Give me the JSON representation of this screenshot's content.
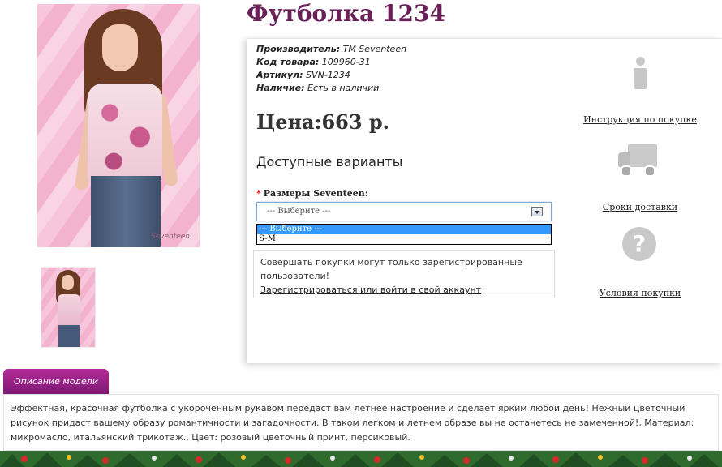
{
  "product": {
    "title": "Футболка 1234",
    "specs": [
      {
        "label": "Производитель:",
        "value": "TM Seventeen"
      },
      {
        "label": "Код товара:",
        "value": "109960-31"
      },
      {
        "label": "Артикул:",
        "value": "SVN-1234"
      },
      {
        "label": "Наличие:",
        "value": "Есть в наличии"
      }
    ],
    "price": "Цена:663 р.",
    "variants_heading": "Доступные варианты",
    "size_select": {
      "label": "Размеры Seventeen:",
      "value": "--- Выберите ---",
      "options": [
        "--- Выберите ---",
        "S-M"
      ]
    },
    "notice": {
      "text": "Совершать покупки могут только зарегистрированные пользователи!",
      "link": "Зарегистрироваться или войти в свой аккаунт"
    },
    "photo_signature": "Seventeen"
  },
  "sidebar": {
    "instruction": "Инструкция по покупке",
    "delivery": "Сроки доставки",
    "conditions": "Условия покупки"
  },
  "description": {
    "tab": "Описание модели",
    "text": "Эффектная, красочная футболка с укороченным рукавом передаст вам летнее настроение и сделает ярким любой день! Нежный цветочный рисунок придаст вашему образу романтичности и загадочности. В таком легком и летнем образе вы не останетесь не замеченной!, Материал: микромасло, итальянский трикотаж., Цвет: розовый цветочный принт, персиковый."
  },
  "colors": {
    "title": "#6a1f58",
    "tab": "#9b2389",
    "selected_option": "#3399ff"
  }
}
